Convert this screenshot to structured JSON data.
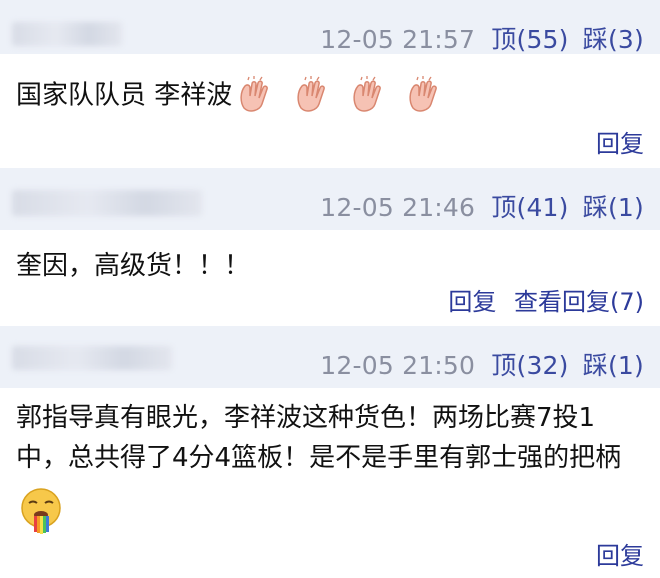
{
  "comments": [
    {
      "time": "12-05 21:57",
      "up_label": "顶(55)",
      "down_label": "踩(3)",
      "text": "国家队队员 李祥波",
      "emoji": "clap-hands-icon",
      "clap_count": 4,
      "actions": [
        "回复"
      ]
    },
    {
      "time": "12-05 21:46",
      "up_label": "顶(41)",
      "down_label": "踩(1)",
      "text": "奎因，高级货！！！",
      "actions": [
        "回复",
        "查看回复(7)"
      ]
    },
    {
      "time": "12-05 21:50",
      "up_label": "顶(32)",
      "down_label": "踩(1)",
      "text_line1": "郭指导真有眼光，李祥波这种货色！两场比赛7投1",
      "text_line2": "中，总共得了4分4篮板！是不是手里有郭士强的把柄",
      "emoji": "rainbow-vomit-icon",
      "actions": [
        "回复"
      ]
    }
  ],
  "colors": {
    "header_bg": "#edf1f8",
    "meta_text": "#8a8fa0",
    "link": "#2c3a9a"
  }
}
